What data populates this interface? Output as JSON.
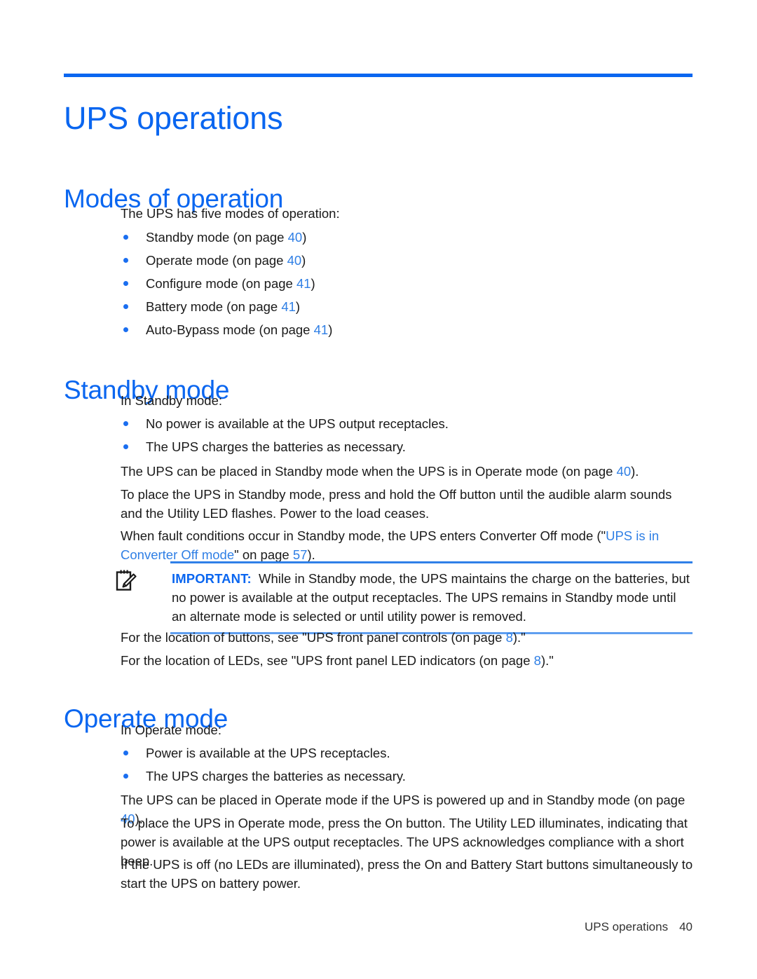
{
  "document": {
    "chapter_title": "UPS operations",
    "footer": {
      "title": "UPS operations",
      "page": "40"
    }
  },
  "sections": {
    "modes": {
      "heading": "Modes of operation",
      "intro": "The UPS has five modes of operation:",
      "items": [
        {
          "text": "Standby mode (on page ",
          "page": "40",
          "after": ")"
        },
        {
          "text": "Operate mode (on page ",
          "page": "40",
          "after": ")"
        },
        {
          "text": "Configure mode (on page ",
          "page": "41",
          "after": ")"
        },
        {
          "text": "Battery mode (on page ",
          "page": "41",
          "after": ")"
        },
        {
          "text": "Auto-Bypass mode (on page ",
          "page": "41",
          "after": ")"
        }
      ]
    },
    "standby": {
      "heading": "Standby mode",
      "intro": "In Standby mode:",
      "items": [
        "No power is available at the UPS output receptacles.",
        "The UPS charges the batteries as necessary."
      ],
      "p1_before": "The UPS can be placed in Standby mode when the UPS is in Operate mode (on page ",
      "p1_page": "40",
      "p1_after": ").",
      "p2": "To place the UPS in Standby mode, press and hold the Off button until the audible alarm sounds and the Utility LED flashes. Power to the load ceases.",
      "p3_before": "When fault conditions occur in Standby mode, the UPS enters Converter Off mode (\"",
      "p3_link": "UPS is in Converter Off mode",
      "p3_mid": "\" on page ",
      "p3_page": "57",
      "p3_after": ").",
      "callout": {
        "icon": "note-pencil-icon",
        "label": "IMPORTANT:",
        "text": "While in Standby mode, the UPS maintains the charge on the batteries, but no power is available at the output receptacles. The UPS remains in Standby mode until an alternate mode is selected or until utility power is removed."
      },
      "p4_before": "For the location of buttons, see \"UPS front panel controls (on page ",
      "p4_page": "8",
      "p4_after": ").\"",
      "p5_before": "For the location of LEDs, see \"UPS front panel LED indicators (on page ",
      "p5_page": "8",
      "p5_after": ").\""
    },
    "operate": {
      "heading": "Operate mode",
      "intro": "In Operate mode:",
      "items": [
        "Power is available at the UPS receptacles.",
        "The UPS charges the batteries as necessary."
      ],
      "p1_before": "The UPS can be placed in Operate mode if the UPS is powered up and in Standby mode (on page ",
      "p1_page": "40",
      "p1_after": ").",
      "p2": "To place the UPS in Operate mode, press the On button. The Utility LED illuminates, indicating that power is available at the UPS output receptacles. The UPS acknowledges compliance with a short beep.",
      "p3": "If the UPS is off (no LEDs are illuminated), press the On and Battery Start buttons simultaneously to start the UPS on battery power."
    }
  },
  "colors": {
    "accent": "#0a66f0",
    "link": "#2f7fe5",
    "text": "#1a1a1a"
  }
}
